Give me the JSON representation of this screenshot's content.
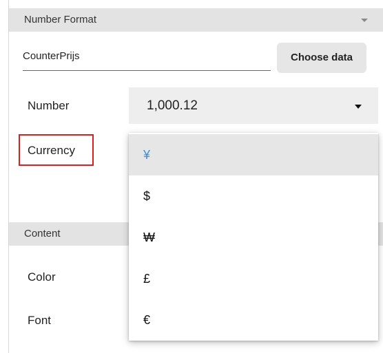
{
  "number_format": {
    "header": "Number Format",
    "name_value": "CounterPrijs",
    "choose_data_label": "Choose data",
    "number_label": "Number",
    "number_selected": "1,000.12",
    "currency_label": "Currency",
    "currency_options": [
      "¥",
      "$",
      "₩",
      "£",
      "€"
    ],
    "currency_selected": "¥"
  },
  "content": {
    "header": "Content",
    "color_label": "Color",
    "font_label": "Font"
  },
  "colors": {
    "selected_text": "#3b8fd9",
    "highlight_border": "#e01b1b",
    "header_bg": "#e3e3e3"
  }
}
